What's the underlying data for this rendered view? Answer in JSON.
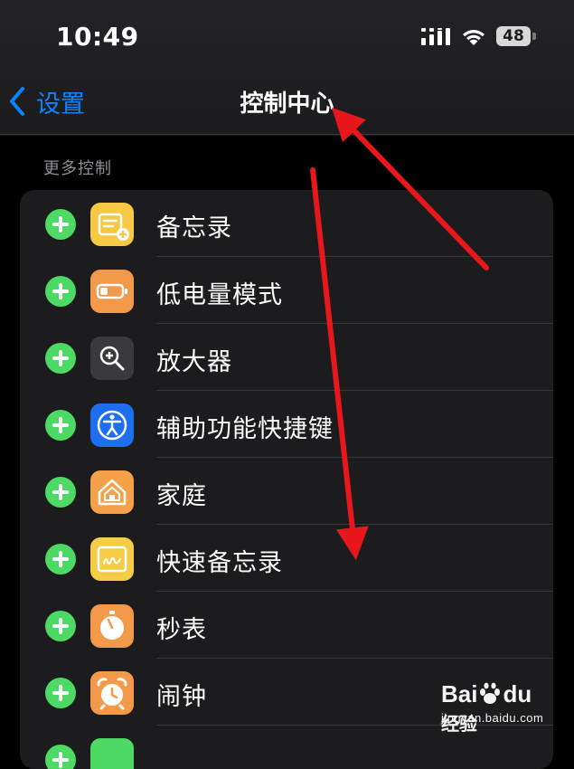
{
  "status_bar": {
    "time": "10:49",
    "battery_level": "48"
  },
  "nav": {
    "back_label": "设置",
    "title": "控制中心"
  },
  "section": {
    "header": "更多控制"
  },
  "items": [
    {
      "label": "备忘录",
      "icon": "notes-icon",
      "color": "#f7c844"
    },
    {
      "label": "低电量模式",
      "icon": "low-power-mode-icon",
      "color": "#f2994a"
    },
    {
      "label": "放大器",
      "icon": "magnifier-icon",
      "color": "#3a3a3c"
    },
    {
      "label": "辅助功能快捷键",
      "icon": "accessibility-icon",
      "color": "#1e6ef0"
    },
    {
      "label": "家庭",
      "icon": "home-icon",
      "color": "#f4a14a"
    },
    {
      "label": "快速备忘录",
      "icon": "quick-note-icon",
      "color": "#f5cc45"
    },
    {
      "label": "秒表",
      "icon": "stopwatch-icon",
      "color": "#f2994a"
    },
    {
      "label": "闹钟",
      "icon": "alarm-icon",
      "color": "#f2994a"
    }
  ],
  "watermark": {
    "brand_left": "Bai",
    "brand_mid": "du",
    "brand_right": "经验",
    "url": "jingyan.baidu.com"
  },
  "annotation": {
    "arrow_color": "#e8171c"
  }
}
